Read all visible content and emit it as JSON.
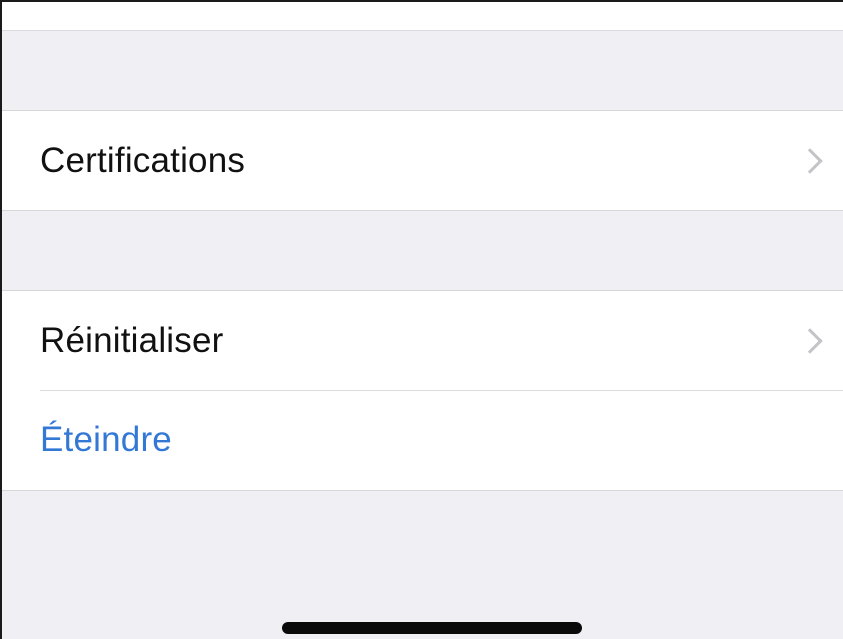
{
  "settings": {
    "rows": [
      {
        "label": "Certifications",
        "has_chevron": true,
        "icon": "chevron-right-icon"
      },
      {
        "label": "Réinitialiser",
        "has_chevron": true,
        "icon": "chevron-right-icon"
      },
      {
        "label": "Éteindre",
        "has_chevron": false,
        "style": "link"
      }
    ]
  },
  "colors": {
    "background": "#efeff4",
    "cell": "#ffffff",
    "text": "#111111",
    "link": "#3478d6",
    "chevron": "#c4c4c8",
    "separator": "#dcdce0"
  }
}
